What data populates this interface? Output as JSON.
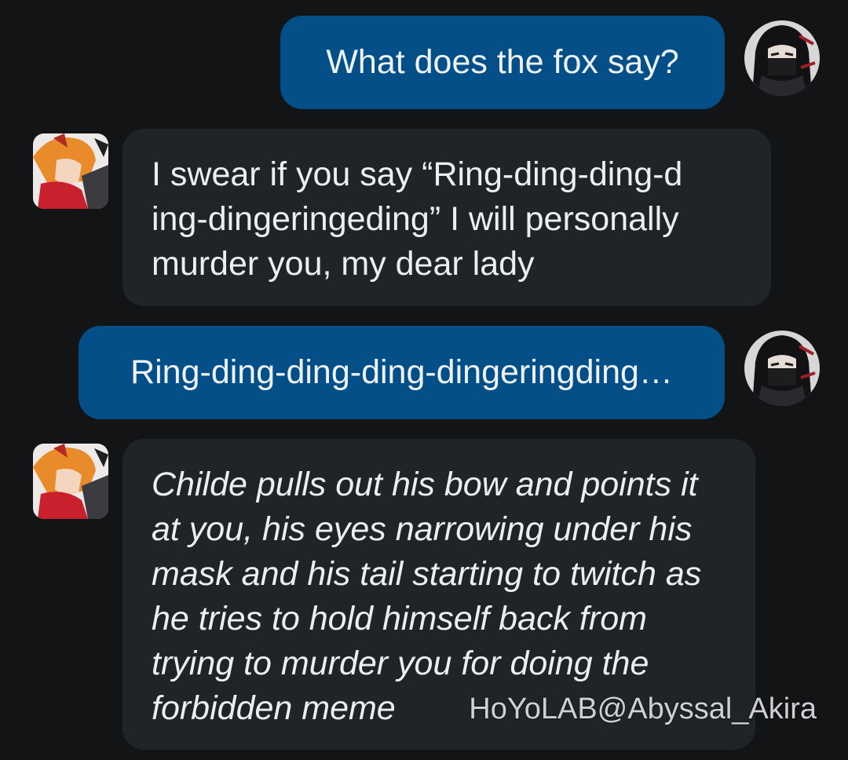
{
  "messages": [
    {
      "role": "user",
      "text": "What does the fox say?"
    },
    {
      "role": "bot",
      "text": "I swear if you say “Ring-ding-ding-d ing-dingeringeding” I will personally murder you, my dear lady"
    },
    {
      "role": "user",
      "text": "Ring-ding-ding-ding-dingeringding…"
    },
    {
      "role": "bot",
      "text": "Childe pulls out his bow and points it at you, his eyes narrowing under his mask and his tail starting to twitch as he tries to hold himself back from trying to murder you for doing the forbidden meme"
    }
  ],
  "avatars": {
    "user": "user-avatar-masked-dark-hair",
    "bot": "bot-avatar-orange-hair-fox-mask"
  },
  "watermark": "HoYoLAB@Abyssal_Akira",
  "colors": {
    "background": "#131416",
    "user_bubble": "#044f88",
    "bot_bubble": "#202327",
    "text": "#eceef1"
  }
}
